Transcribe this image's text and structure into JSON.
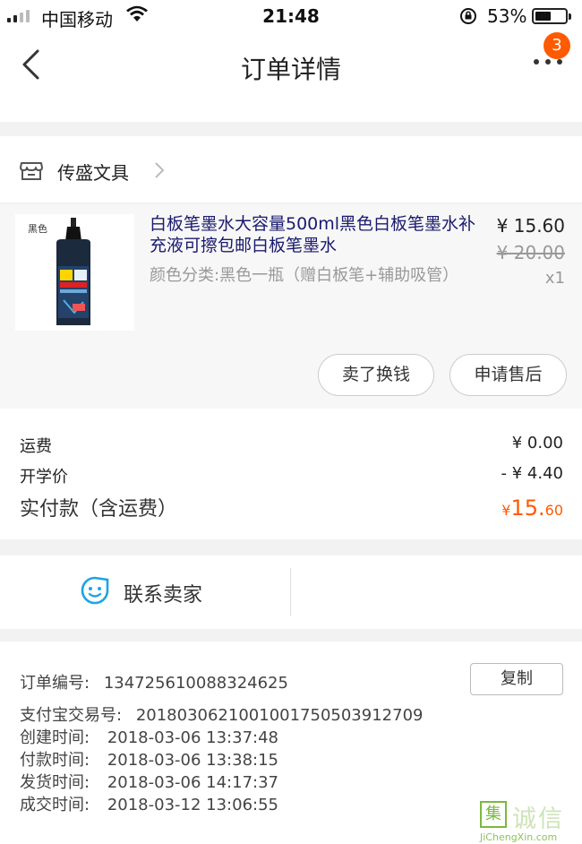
{
  "status_bar": {
    "carrier": "中国移动",
    "time": "21:48",
    "battery": "53%",
    "battery_level": 0.53
  },
  "nav": {
    "title": "订单详情",
    "badge": "3"
  },
  "shop": {
    "name": "传盛文具"
  },
  "product": {
    "image_tag": "黑色",
    "title": "白板笔墨水大容量500ml黑色白板笔墨水补充液可擦包邮白板笔墨水",
    "spec": "颜色分类:黑色一瓶（赠白板笔+辅助吸管）",
    "price": "¥ 15.60",
    "original_price": "¥ 20.00",
    "quantity": "x1",
    "actions": [
      "卖了换钱",
      "申请售后"
    ]
  },
  "fees": {
    "shipping_label": "运费",
    "shipping_value": "¥ 0.00",
    "discount_label": "开学价",
    "discount_value": "- ¥ 4.40",
    "total_label": "实付款（含运费）",
    "total_currency": "¥",
    "total_int": "15.",
    "total_dec": "60"
  },
  "contact": {
    "label": "联系卖家"
  },
  "order_info": {
    "order_no_label": "订单编号:",
    "order_no": "134725610088324625",
    "copy_label": "复制",
    "alipay_label": "支付宝交易号:",
    "alipay_no": "2018030621001001750503912709",
    "created_label": "创建时间:",
    "created": "2018-03-06 13:37:48",
    "paid_label": "付款时间:",
    "paid": "2018-03-06 13:38:15",
    "shipped_label": "发货时间:",
    "shipped": "2018-03-06 14:17:37",
    "completed_label": "成交时间:",
    "completed": "2018-03-12 13:06:55"
  },
  "watermark": {
    "mark": "集",
    "text": "诚信",
    "url": "JiChengXin.com"
  }
}
